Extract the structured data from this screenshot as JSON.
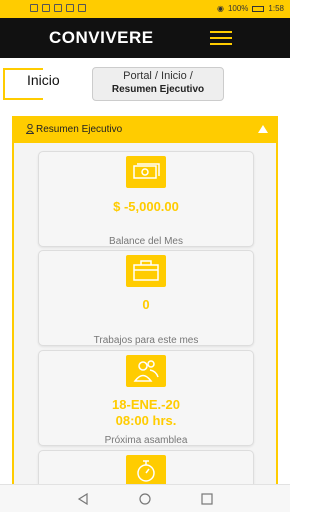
{
  "status_bar": {
    "battery": "100%",
    "time": "1:58"
  },
  "app_bar": {
    "title": "CONVIVERE"
  },
  "page": {
    "heading": "Inicio",
    "breadcrumb_path": "Portal / Inicio /",
    "breadcrumb_current": "Resumen Ejecutivo"
  },
  "panel": {
    "title": "Resumen Ejecutivo",
    "cards": [
      {
        "icon": "money-icon",
        "value": "$ -5,000.00",
        "label": "Balance del Mes"
      },
      {
        "icon": "briefcase-icon",
        "value": "0",
        "label": "Trabajos para este mes"
      },
      {
        "icon": "group-icon",
        "value": "18-ENE.-20\n08:00 hrs.",
        "value_line1": "18-ENE.-20",
        "value_line2": "08:00 hrs.",
        "label": "Próxima asamblea"
      },
      {
        "icon": "stopwatch-icon"
      }
    ]
  },
  "colors": {
    "accent": "#ffcc00",
    "app_bar_bg": "#111111",
    "panel_bg": "#f4f4f4"
  }
}
